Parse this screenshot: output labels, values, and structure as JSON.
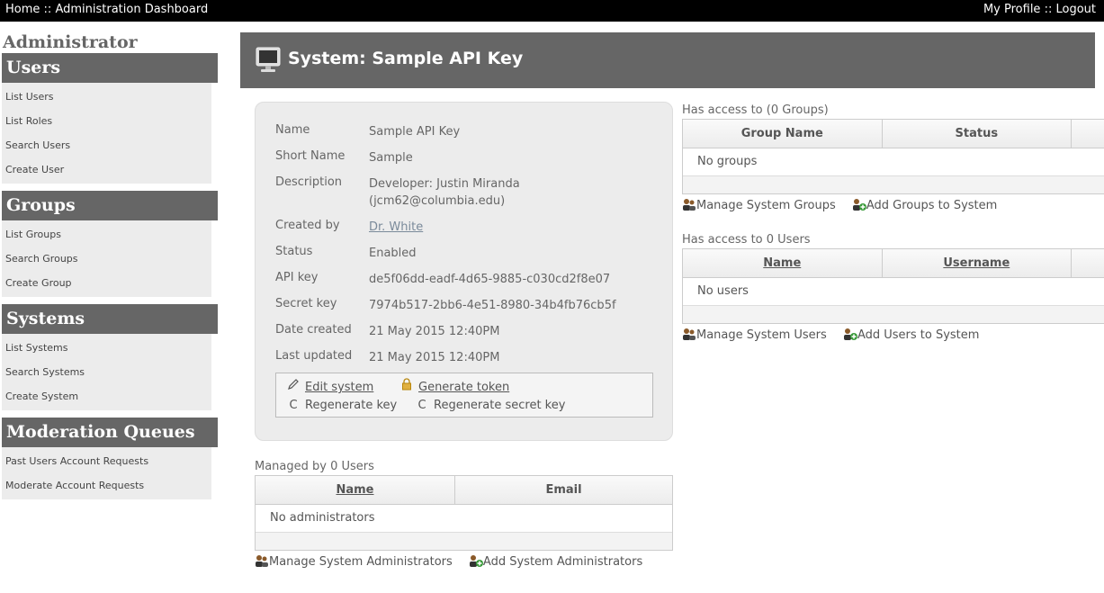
{
  "topbar": {
    "home": "Home",
    "separator": "::",
    "dashboard": "Administration Dashboard",
    "profile": "My Profile",
    "logout": "Logout"
  },
  "sidebar": {
    "title": "Administrator",
    "sections": [
      {
        "title": "Users",
        "items": [
          "List Users",
          "List Roles",
          "Search Users",
          "Create User"
        ]
      },
      {
        "title": "Groups",
        "items": [
          "List Groups",
          "Search Groups",
          "Create Group"
        ]
      },
      {
        "title": "Systems",
        "items": [
          "List Systems",
          "Search Systems",
          "Create System"
        ]
      },
      {
        "title": "Moderation Queues",
        "items": [
          "Past Users Account Requests",
          "Moderate Account Requests"
        ]
      }
    ]
  },
  "header": {
    "title": "System: Sample API Key",
    "icon": "monitor-icon"
  },
  "info": {
    "name_label": "Name",
    "name": "Sample API Key",
    "short_label": "Short Name",
    "short": "Sample",
    "desc_label": "Description",
    "desc_line1": "Developer: Justin Miranda",
    "desc_line2": "(jcm62@columbia.edu)",
    "created_by_label": "Created by",
    "created_by": "Dr. White",
    "status_label": "Status",
    "status": "Enabled",
    "api_key_label": "API key",
    "api_key": "de5f06dd-eadf-4d65-9885-c030cd2f8e07",
    "secret_label": "Secret key",
    "secret": "7974b517-2bb6-4e51-8980-34b4fb76cb5f",
    "date_created_label": "Date created",
    "date_created": "21 May 2015 12:40PM",
    "last_updated_label": "Last updated",
    "last_updated": "21 May 2015 12:40PM"
  },
  "actions": {
    "edit": "Edit system",
    "token": "Generate token",
    "regen_key": "Regenerate key",
    "regen_secret": "Regenerate secret key"
  },
  "admins": {
    "caption": "Managed by 0 Users",
    "col_name": "Name",
    "col_email": "Email",
    "empty": "No administrators",
    "manage": "Manage System Administrators",
    "add": "Add System Administrators"
  },
  "groups": {
    "caption": "Has access to (0 Groups)",
    "col_name": "Group Name",
    "col_status": "Status",
    "empty": "No groups",
    "manage": "Manage System Groups",
    "add": "Add Groups to System"
  },
  "users": {
    "caption": "Has access to 0 Users",
    "col_name": "Name",
    "col_username": "Username",
    "empty": "No users",
    "manage": "Manage System Users",
    "add": "Add Users to System"
  }
}
